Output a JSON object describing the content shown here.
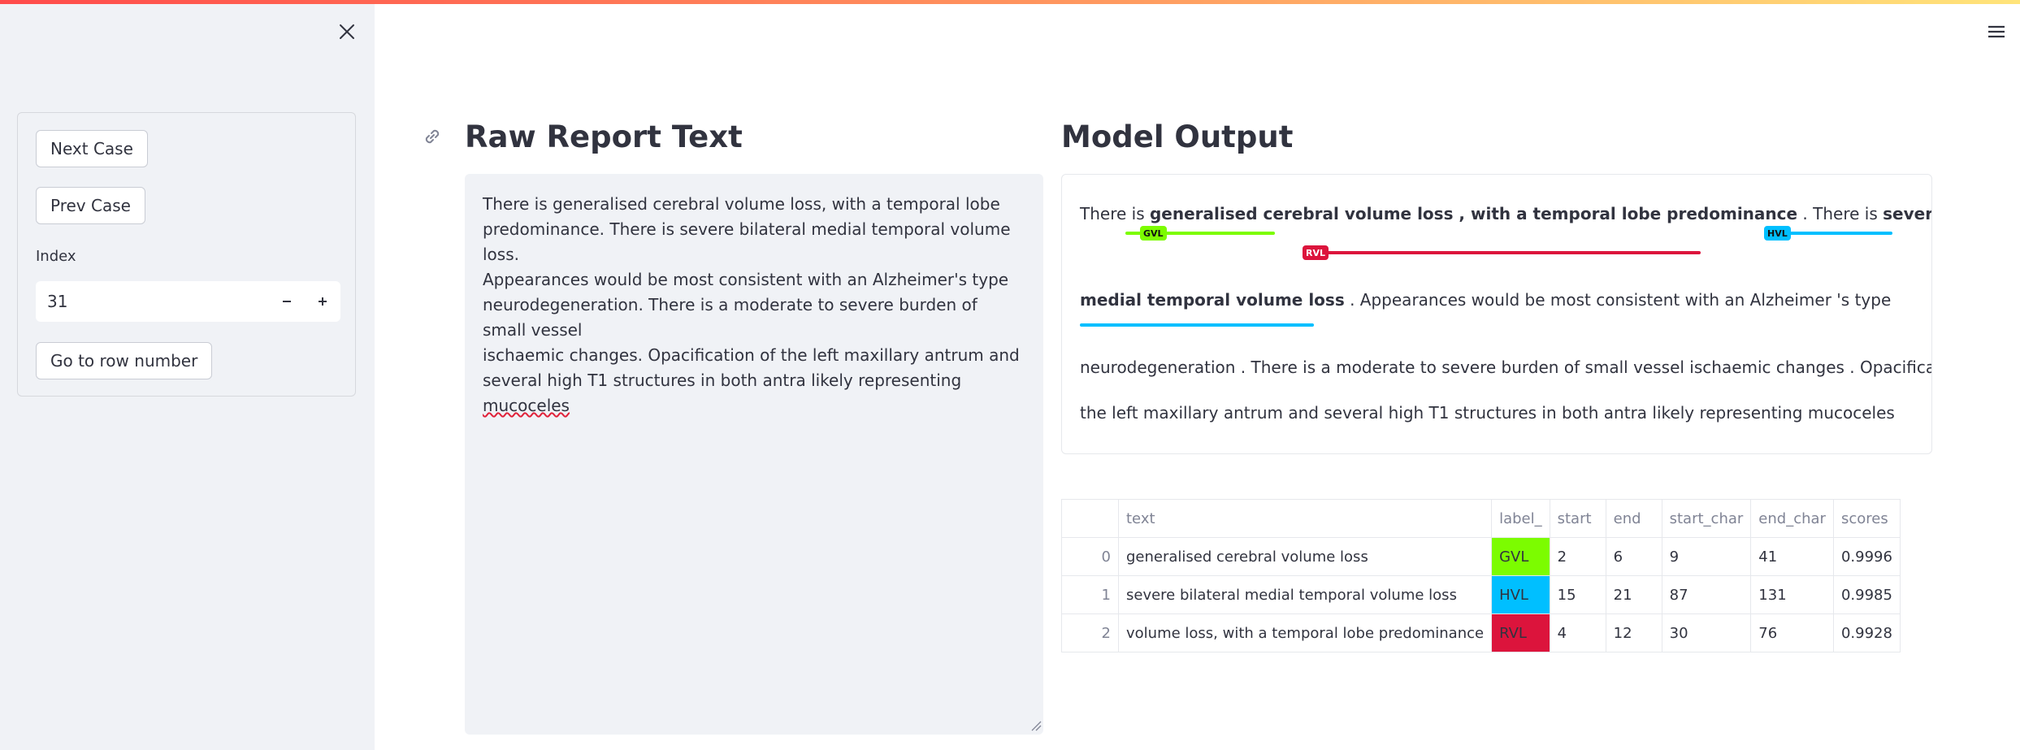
{
  "sidebar": {
    "next_label": "Next Case",
    "prev_label": "Prev Case",
    "index_label": "Index",
    "index_value": "31",
    "goto_label": "Go to row number"
  },
  "raw": {
    "title": "Raw Report Text",
    "lines": [
      "There is generalised cerebral volume loss, with a temporal lobe",
      "predominance. There is severe bilateral medial temporal volume loss.",
      "Appearances would be most consistent with an Alzheimer's type",
      "neurodegeneration. There is a moderate to severe burden of small vessel",
      "ischaemic changes. Opacification of the left maxillary antrum and",
      "several high T1 structures in both antra likely representing"
    ],
    "last_word": "mucoceles"
  },
  "output": {
    "title": "Model Output",
    "line1": {
      "pre": "There is ",
      "ent1": "generalised cerebral volume loss , with a temporal lobe predominance",
      "mid": " . There is ",
      "ent2": "severe bilateral"
    },
    "line2": {
      "ent": "medial temporal volume loss",
      "post": " . Appearances would be most consistent with an Alzheimer 's type"
    },
    "line3": "neurodegeneration . There is a moderate to severe burden of small vessel ischaemic changes . Opacification of",
    "line4": "the left maxillary antrum and several high T1 structures in both antra likely representing mucoceles",
    "tags": {
      "gvl": "GVL",
      "rvl": "RVL",
      "hvl": "HVL"
    }
  },
  "colors": {
    "gvl": "#7cfc00",
    "hvl": "#00bfff",
    "rvl": "#dc143c"
  },
  "table": {
    "headers": [
      "",
      "text",
      "label_",
      "start",
      "end",
      "start_char",
      "end_char",
      "scores"
    ],
    "rows": [
      [
        "0",
        "generalised cerebral volume loss",
        "GVL",
        "2",
        "6",
        "9",
        "41",
        "0.9996"
      ],
      [
        "1",
        "severe bilateral medial temporal volume loss",
        "HVL",
        "15",
        "21",
        "87",
        "131",
        "0.9985"
      ],
      [
        "2",
        "volume loss, with a temporal lobe predominance",
        "RVL",
        "4",
        "12",
        "30",
        "76",
        "0.9928"
      ]
    ]
  },
  "icons": [
    "close-icon",
    "menu-icon",
    "link-icon",
    "minus-icon",
    "plus-icon",
    "resize-icon"
  ]
}
